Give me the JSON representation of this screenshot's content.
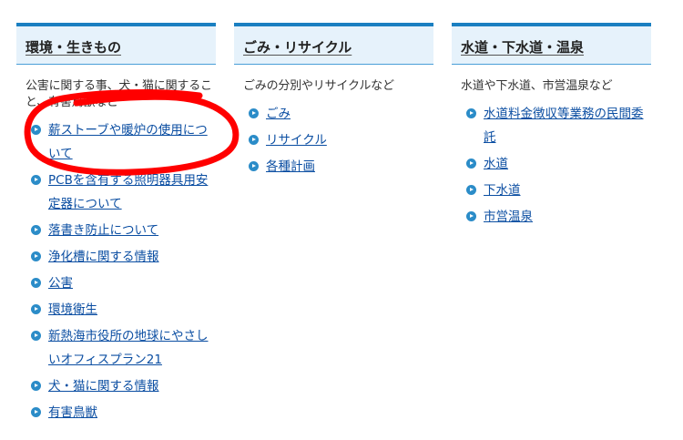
{
  "columns": [
    {
      "title": "環境・生きもの",
      "description": "公害に関する事、犬・猫に関すること、有害鳥獣など",
      "items": [
        "薪ストーブや暖炉の使用について",
        "PCBを含有する照明器具用安定器について",
        "落書き防止について",
        "浄化槽に関する情報",
        "公害",
        "環境衛生",
        "新熱海市役所の地球にやさしいオフィスプラン21",
        "犬・猫に関する情報",
        "有害鳥獣"
      ]
    },
    {
      "title": "ごみ・リサイクル",
      "description": "ごみの分別やリサイクルなど",
      "items": [
        "ごみ",
        "リサイクル",
        "各種計画"
      ]
    },
    {
      "title": "水道・下水道・温泉",
      "description": "水道や下水道、市営温泉など",
      "items": [
        "水道料金徴収等業務の民間委託",
        "水道",
        "下水道",
        "市営温泉"
      ]
    }
  ],
  "colors": {
    "accent": "#1a7fc1",
    "header_bg": "#e6f2fb",
    "link": "#0b4ea2",
    "annotation": "#ff0000"
  }
}
